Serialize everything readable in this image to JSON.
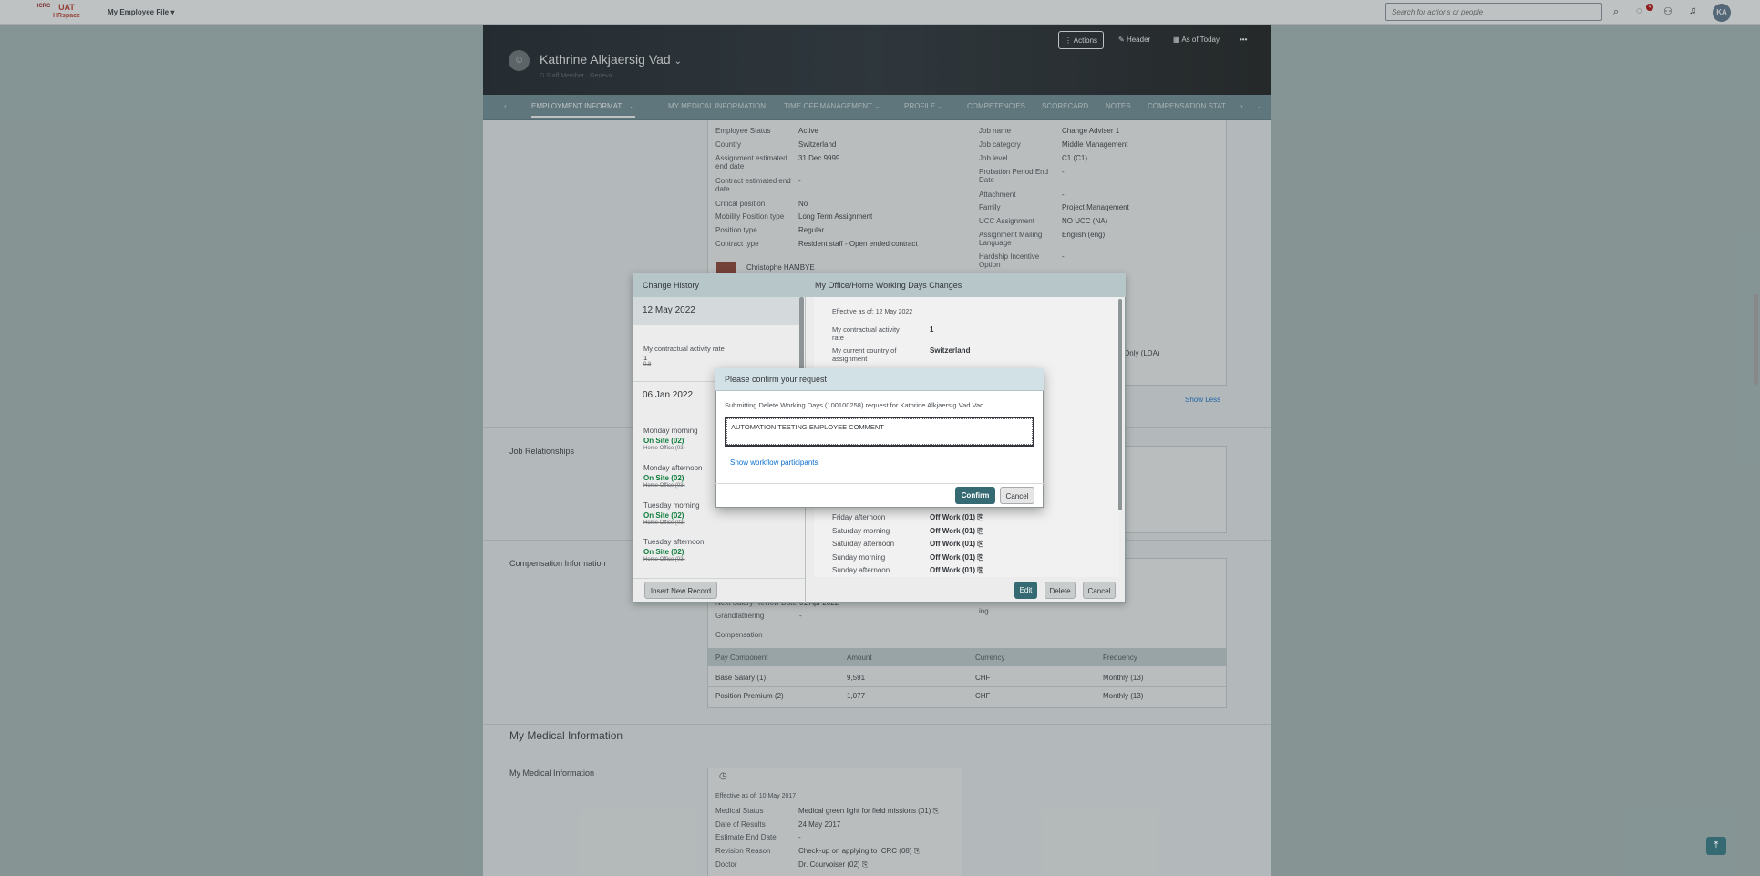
{
  "shell": {
    "logo_org": "ICRC",
    "logo_env": "UAT",
    "logo_app": "HRspace",
    "menu_label": "My Employee File",
    "search_placeholder": "Search for actions or people",
    "notification_count": "4",
    "avatar_initials": "KA"
  },
  "header": {
    "employee_name": "Kathrine Alkjaersig Vad",
    "subtitle": "D Staff Member · Geneva",
    "actions_label": "Actions",
    "header_label": "Header",
    "as_of_label": "As of Today"
  },
  "tabs": [
    {
      "label": "EMPLOYMENT INFORMAT..."
    },
    {
      "label": "MY MEDICAL INFORMATION"
    },
    {
      "label": "TIME OFF MANAGEMENT"
    },
    {
      "label": "PROFILE"
    },
    {
      "label": "COMPETENCIES"
    },
    {
      "label": "SCORECARD"
    },
    {
      "label": "NOTES"
    },
    {
      "label": "COMPENSATION STAT"
    }
  ],
  "employment": {
    "left_fields": [
      {
        "label": "Employee Status",
        "value": "Active"
      },
      {
        "label": "Country",
        "value": "Switzerland"
      },
      {
        "label": "Assignment estimated end date",
        "value": "31 Dec 9999"
      },
      {
        "label": "Contract estimated end date",
        "value": "-"
      },
      {
        "label": "Critical position",
        "value": "No"
      },
      {
        "label": "Mobility Position type",
        "value": "Long Term Assignment"
      },
      {
        "label": "Position type",
        "value": "Regular"
      },
      {
        "label": "Contract type",
        "value": "Resident staff - Open ended contract"
      }
    ],
    "manager_name": "Christophe HAMBYE",
    "right_fields": [
      {
        "label": "Job name",
        "value": "Change Adviser 1"
      },
      {
        "label": "Job category",
        "value": "Middle Management"
      },
      {
        "label": "Job level",
        "value": "C1 (C1)"
      },
      {
        "label": "Probation Period End Date",
        "value": "-"
      },
      {
        "label": "Attachment",
        "value": "-"
      },
      {
        "label": "Family",
        "value": "Project Management"
      },
      {
        "label": "UCC Assignment",
        "value": "NO UCC (NA)"
      },
      {
        "label": "Assignment Mailing Language",
        "value": "English (eng)"
      },
      {
        "label": "Hardship Incentive Option",
        "value": "-"
      }
    ],
    "partial_right_value": "Only (LDA)",
    "show_less": "Show Less"
  },
  "job_relationships": {
    "title": "Job Relationships"
  },
  "compensation": {
    "title": "Compensation Information",
    "grandfathering_label": "Grandfathering",
    "grandfathering_value": "-",
    "partial_left": "Next Salary Review Date",
    "partial_value": "01 Apr 2022",
    "partial_right": "ing",
    "section_label": "Compensation",
    "columns": [
      "Pay Component",
      "Amount",
      "Currency",
      "Frequency"
    ],
    "rows": [
      [
        "Base Salary (1)",
        "9,591",
        "CHF",
        "Monthly (13)"
      ],
      [
        "Position Premium (2)",
        "1,077",
        "CHF",
        "Monthly (13)"
      ]
    ]
  },
  "medical": {
    "section_title": "My Medical Information",
    "subsection_title": "My Medical Information",
    "effective": "Effective as of: 10 May 2017",
    "fields": [
      {
        "label": "Medical Status",
        "value": "Medical green light for field missions (01)"
      },
      {
        "label": "Date of Results",
        "value": "24 May 2017"
      },
      {
        "label": "Estimate End Date",
        "value": "-"
      },
      {
        "label": "Revision Reason",
        "value": "Check-up on applying to ICRC (08)"
      },
      {
        "label": "Doctor",
        "value": "Dr. Courvoiser (02)"
      }
    ]
  },
  "history": {
    "left_title": "Change History",
    "right_title": "My Office/Home Working Days Changes",
    "date1": "12 May 2022",
    "rate_label": "My contractual activity rate",
    "rate_new": "1",
    "rate_old": "0.8",
    "date2": "06 Jan 2022",
    "days": [
      {
        "label": "Monday morning",
        "new": "On Site (02)",
        "old": "Home Office (03)"
      },
      {
        "label": "Monday afternoon",
        "new": "On Site (02)",
        "old": "Home Office (03)"
      },
      {
        "label": "Tuesday morning",
        "new": "On Site (02)",
        "old": "Home Office (03)"
      },
      {
        "label": "Tuesday afternoon",
        "new": "On Site (02)",
        "old": "Home Office (03)"
      }
    ],
    "insert_button": "Insert New Record",
    "effective": "Effective as of: 12 May 2022",
    "right_fields": [
      {
        "label": "My contractual activity rate",
        "value": "1"
      },
      {
        "label": "My current country of assignment",
        "value": "Switzerland"
      }
    ],
    "week_rows": [
      {
        "label": "Friday afternoon",
        "value": "Off Work (01)"
      },
      {
        "label": "Saturday morning",
        "value": "Off Work (01)"
      },
      {
        "label": "Saturday afternoon",
        "value": "Off Work (01)"
      },
      {
        "label": "Sunday morning",
        "value": "Off Work (01)"
      },
      {
        "label": "Sunday afternoon",
        "value": "Off Work (01)"
      }
    ],
    "edit_button": "Edit",
    "delete_button": "Delete",
    "cancel_button": "Cancel"
  },
  "dialog": {
    "title": "Please confirm your request",
    "message": "Submitting Delete Working Days (100100258) request for Kathrine Alkjaersig Vad Vad.",
    "comment": "AUTOMATION TESTING EMPLOYEE COMMENT",
    "workflow_link": "Show workflow participants",
    "confirm": "Confirm",
    "cancel": "Cancel"
  }
}
